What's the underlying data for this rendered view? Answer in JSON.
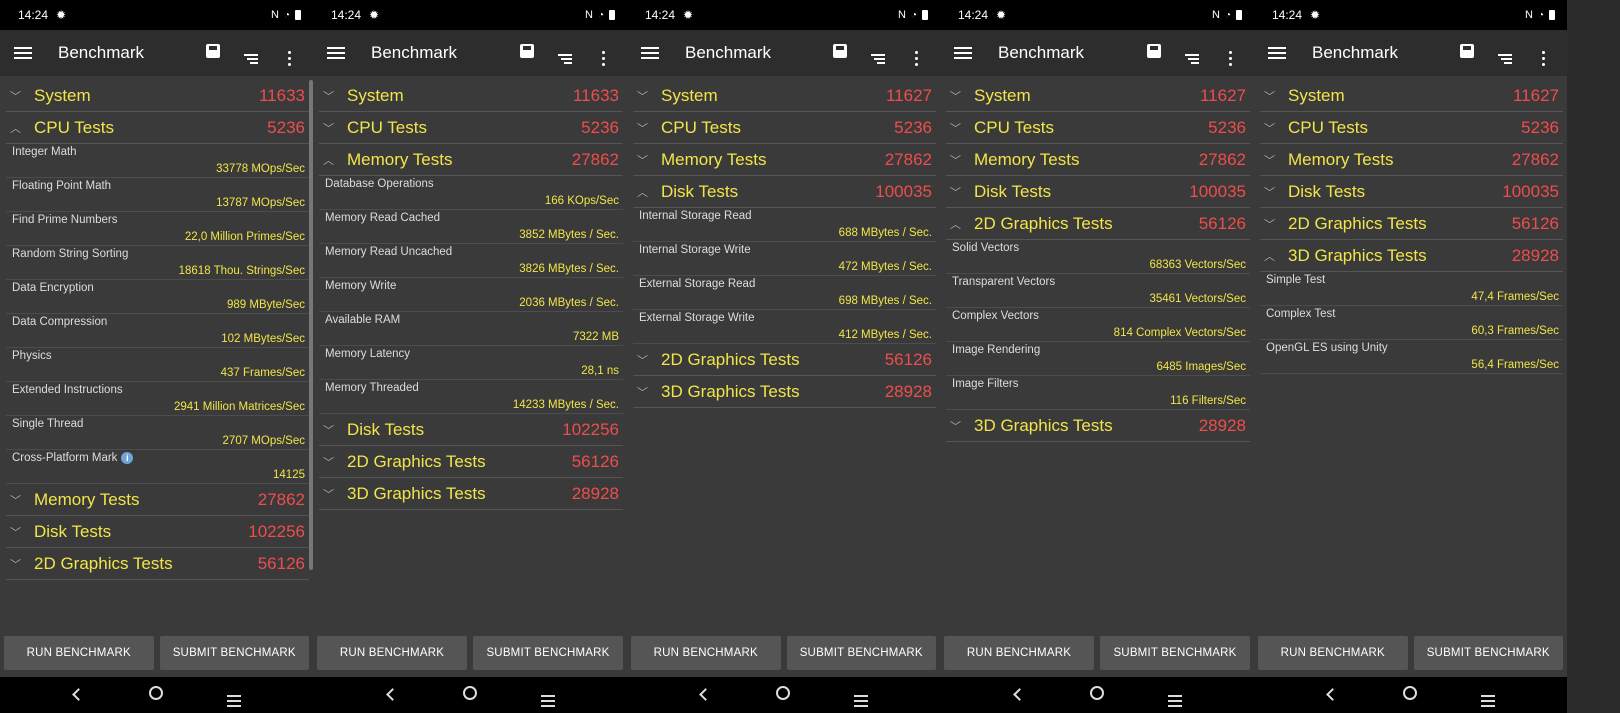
{
  "statusbar": {
    "time": "14:24",
    "nfc": "N"
  },
  "appbar": {
    "title": "Benchmark"
  },
  "buttons": {
    "run": "RUN BENCHMARK",
    "submit": "SUBMIT BENCHMARK"
  },
  "phones": [
    {
      "sections": [
        {
          "label": "System",
          "score": "11633",
          "expanded": false
        },
        {
          "label": "CPU Tests",
          "score": "5236",
          "expanded": true,
          "items": [
            {
              "name": "Integer Math",
              "value": "33778 MOps/Sec"
            },
            {
              "name": "Floating Point Math",
              "value": "13787 MOps/Sec"
            },
            {
              "name": "Find Prime Numbers",
              "value": "22,0 Million Primes/Sec"
            },
            {
              "name": "Random String Sorting",
              "value": "18618 Thou. Strings/Sec"
            },
            {
              "name": "Data Encryption",
              "value": "989 MByte/Sec"
            },
            {
              "name": "Data Compression",
              "value": "102 MBytes/Sec"
            },
            {
              "name": "Physics",
              "value": "437 Frames/Sec"
            },
            {
              "name": "Extended Instructions",
              "value": "2941 Million Matrices/Sec"
            },
            {
              "name": "Single Thread",
              "value": "2707 MOps/Sec"
            },
            {
              "name": "Cross-Platform Mark",
              "value": "14125",
              "info": true
            }
          ]
        },
        {
          "label": "Memory Tests",
          "score": "27862",
          "expanded": false
        },
        {
          "label": "Disk Tests",
          "score": "102256",
          "expanded": false
        },
        {
          "label": "2D Graphics Tests",
          "score": "56126",
          "expanded": false
        }
      ]
    },
    {
      "sections": [
        {
          "label": "System",
          "score": "11633",
          "expanded": false
        },
        {
          "label": "CPU Tests",
          "score": "5236",
          "expanded": false
        },
        {
          "label": "Memory Tests",
          "score": "27862",
          "expanded": true,
          "items": [
            {
              "name": "Database Operations",
              "value": "166 KOps/Sec"
            },
            {
              "name": "Memory Read Cached",
              "value": "3852 MBytes / Sec."
            },
            {
              "name": "Memory Read Uncached",
              "value": "3826 MBytes / Sec."
            },
            {
              "name": "Memory Write",
              "value": "2036 MBytes / Sec."
            },
            {
              "name": "Available RAM",
              "value": "7322 MB"
            },
            {
              "name": "Memory Latency",
              "value": "28,1 ns"
            },
            {
              "name": "Memory Threaded",
              "value": "14233 MBytes / Sec."
            }
          ]
        },
        {
          "label": "Disk Tests",
          "score": "102256",
          "expanded": false
        },
        {
          "label": "2D Graphics Tests",
          "score": "56126",
          "expanded": false
        },
        {
          "label": "3D Graphics Tests",
          "score": "28928",
          "expanded": false
        }
      ]
    },
    {
      "sections": [
        {
          "label": "System",
          "score": "11627",
          "expanded": false
        },
        {
          "label": "CPU Tests",
          "score": "5236",
          "expanded": false
        },
        {
          "label": "Memory Tests",
          "score": "27862",
          "expanded": false
        },
        {
          "label": "Disk Tests",
          "score": "100035",
          "expanded": true,
          "items": [
            {
              "name": "Internal Storage Read",
              "value": "688 MBytes / Sec."
            },
            {
              "name": "Internal Storage Write",
              "value": "472 MBytes / Sec."
            },
            {
              "name": "External Storage Read",
              "value": "698 MBytes / Sec."
            },
            {
              "name": "External Storage Write",
              "value": "412 MBytes / Sec."
            }
          ]
        },
        {
          "label": "2D Graphics Tests",
          "score": "56126",
          "expanded": false
        },
        {
          "label": "3D Graphics Tests",
          "score": "28928",
          "expanded": false
        }
      ]
    },
    {
      "sections": [
        {
          "label": "System",
          "score": "11627",
          "expanded": false
        },
        {
          "label": "CPU Tests",
          "score": "5236",
          "expanded": false
        },
        {
          "label": "Memory Tests",
          "score": "27862",
          "expanded": false
        },
        {
          "label": "Disk Tests",
          "score": "100035",
          "expanded": false
        },
        {
          "label": "2D Graphics Tests",
          "score": "56126",
          "expanded": true,
          "items": [
            {
              "name": "Solid Vectors",
              "value": "68363 Vectors/Sec"
            },
            {
              "name": "Transparent Vectors",
              "value": "35461 Vectors/Sec"
            },
            {
              "name": "Complex Vectors",
              "value": "814 Complex Vectors/Sec"
            },
            {
              "name": "Image Rendering",
              "value": "6485 Images/Sec"
            },
            {
              "name": "Image Filters",
              "value": "116 Filters/Sec"
            }
          ]
        },
        {
          "label": "3D Graphics Tests",
          "score": "28928",
          "expanded": false
        }
      ]
    },
    {
      "sections": [
        {
          "label": "System",
          "score": "11627",
          "expanded": false
        },
        {
          "label": "CPU Tests",
          "score": "5236",
          "expanded": false
        },
        {
          "label": "Memory Tests",
          "score": "27862",
          "expanded": false
        },
        {
          "label": "Disk Tests",
          "score": "100035",
          "expanded": false
        },
        {
          "label": "2D Graphics Tests",
          "score": "56126",
          "expanded": false
        },
        {
          "label": "3D Graphics Tests",
          "score": "28928",
          "expanded": true,
          "items": [
            {
              "name": "Simple Test",
              "value": "47,4 Frames/Sec"
            },
            {
              "name": "Complex Test",
              "value": "60,3 Frames/Sec"
            },
            {
              "name": "OpenGL ES using Unity",
              "value": "56,4 Frames/Sec"
            }
          ]
        }
      ]
    }
  ]
}
